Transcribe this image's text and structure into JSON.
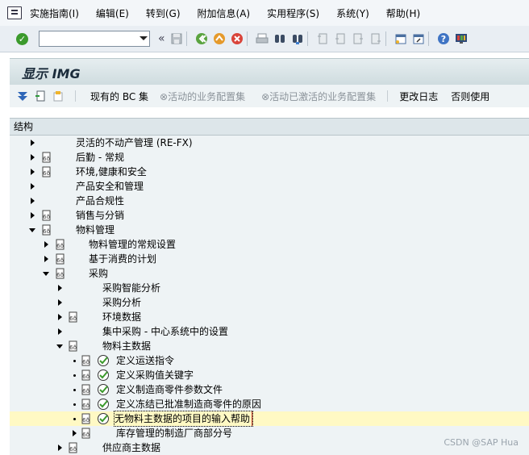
{
  "menu": {
    "items": [
      {
        "label": "实施指南(I)"
      },
      {
        "label": "编辑(E)"
      },
      {
        "label": "转到(G)"
      },
      {
        "label": "附加信息(A)"
      },
      {
        "label": "实用程序(S)"
      },
      {
        "label": "系统(Y)"
      },
      {
        "label": "帮助(H)"
      }
    ]
  },
  "toolbar": {
    "command_value": "",
    "back_glyph": "«"
  },
  "title": {
    "text": "显示 IMG"
  },
  "app_toolbar": {
    "current_bc_set": "现有的 BC 集",
    "active_bc_set": "活动的业务配置集",
    "bc_set_activated": "活动已激活的业务配置集",
    "change_log": "更改日志",
    "otherwise_use": "否则使用"
  },
  "tree": {
    "header": "结构",
    "rows": [
      {
        "label": "灵活的不动产管理 (RE-FX)"
      },
      {
        "label": "后勤 - 常规"
      },
      {
        "label": "环境,健康和安全"
      },
      {
        "label": "产品安全和管理"
      },
      {
        "label": "产品合规性"
      },
      {
        "label": "销售与分销"
      },
      {
        "label": "物料管理"
      },
      {
        "label": "物料管理的常规设置"
      },
      {
        "label": "基于消费的计划"
      },
      {
        "label": "采购"
      },
      {
        "label": "采购智能分析"
      },
      {
        "label": "采购分析"
      },
      {
        "label": "环境数据"
      },
      {
        "label": "集中采购 - 中心系统中的设置"
      },
      {
        "label": "物料主数据"
      },
      {
        "label": "定义运送指令"
      },
      {
        "label": "定义采购值关键字"
      },
      {
        "label": "定义制造商零件参数文件"
      },
      {
        "label": "定义冻结已批准制造商零件的原因"
      },
      {
        "label": "无物料主数据的项目的输入帮助"
      },
      {
        "label": "库存管理的制造厂商部分号"
      },
      {
        "label": "供应商主数据"
      }
    ]
  },
  "watermark": "CSDN @SAP Hua",
  "colors": {
    "highlight_row": "#fff9c4",
    "title_bg": "#d6e1e4",
    "tree_bg": "#eef3f5"
  }
}
